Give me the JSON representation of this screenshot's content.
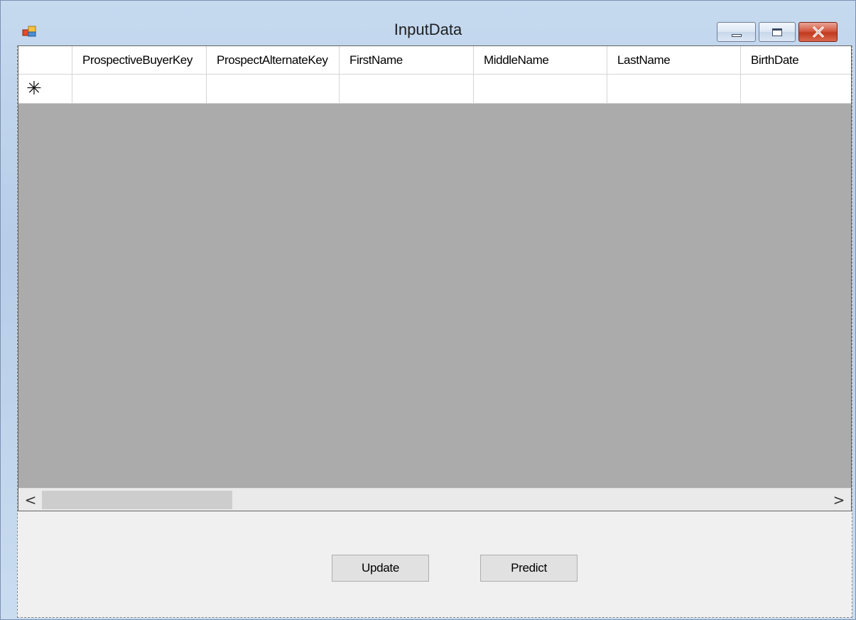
{
  "window": {
    "title": "InputData",
    "icon": "windows-form-icon"
  },
  "title_controls": {
    "minimize_icon": "minimize-icon",
    "maximize_icon": "restore-icon",
    "close_icon": "close-icon",
    "close_glyph": "✕"
  },
  "grid": {
    "columns": [
      "ProspectiveBuyerKey",
      "ProspectAlternateKey",
      "FirstName",
      "MiddleName",
      "LastName",
      "BirthDate"
    ],
    "new_row_marker": "✳",
    "rows": []
  },
  "scrollbar": {
    "left_arrow": "<",
    "right_arrow": ">"
  },
  "buttons": {
    "update_label": "Update",
    "predict_label": "Predict"
  },
  "colors": {
    "grid_background": "#ababab",
    "client_background": "#f0f0f0",
    "close_button": "#c13a1f"
  }
}
